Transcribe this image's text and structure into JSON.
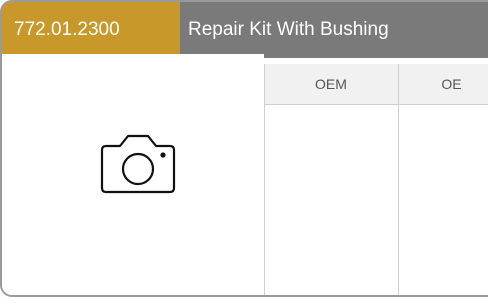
{
  "product": {
    "part_number": "772.01.2300",
    "name": "Repair Kit With Bushing",
    "header_color": "#7a7a7a",
    "accent_color": "#c9982a"
  },
  "photo": {
    "icon": "camera-icon"
  },
  "table": {
    "columns": [
      {
        "label": "OEM"
      },
      {
        "label": "OE"
      }
    ]
  }
}
